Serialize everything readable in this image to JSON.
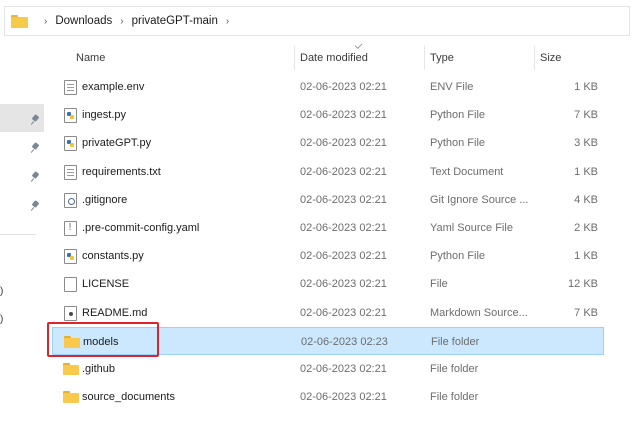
{
  "breadcrumb": {
    "items": [
      "Downloads",
      "privateGPT-main"
    ]
  },
  "columns": {
    "name": "Name",
    "date": "Date modified",
    "type": "Type",
    "size": "Size"
  },
  "files": [
    {
      "name": "example.env",
      "date": "02-06-2023 02:21",
      "type": "ENV File",
      "size": "1 KB",
      "icon": "document-icon"
    },
    {
      "name": "ingest.py",
      "date": "02-06-2023 02:21",
      "type": "Python File",
      "size": "7 KB",
      "icon": "python-file-icon"
    },
    {
      "name": "privateGPT.py",
      "date": "02-06-2023 02:21",
      "type": "Python File",
      "size": "3 KB",
      "icon": "python-file-icon"
    },
    {
      "name": "requirements.txt",
      "date": "02-06-2023 02:21",
      "type": "Text Document",
      "size": "1 KB",
      "icon": "text-document-icon"
    },
    {
      "name": ".gitignore",
      "date": "02-06-2023 02:21",
      "type": "Git Ignore Source ...",
      "size": "4 KB",
      "icon": "config-file-icon"
    },
    {
      "name": ".pre-commit-config.yaml",
      "date": "02-06-2023 02:21",
      "type": "Yaml Source File",
      "size": "2 KB",
      "icon": "yaml-file-icon"
    },
    {
      "name": "constants.py",
      "date": "02-06-2023 02:21",
      "type": "Python File",
      "size": "1 KB",
      "icon": "python-file-icon"
    },
    {
      "name": "LICENSE",
      "date": "02-06-2023 02:21",
      "type": "File",
      "size": "12 KB",
      "icon": "blank-file-icon"
    },
    {
      "name": "README.md",
      "date": "02-06-2023 02:21",
      "type": "Markdown Source...",
      "size": "7 KB",
      "icon": "markdown-file-icon"
    },
    {
      "name": "models",
      "date": "02-06-2023 02:23",
      "type": "File folder",
      "size": "",
      "icon": "folder-icon"
    },
    {
      "name": ".github",
      "date": "02-06-2023 02:21",
      "type": "File folder",
      "size": "",
      "icon": "folder-icon"
    },
    {
      "name": "source_documents",
      "date": "02-06-2023 02:21",
      "type": "File folder",
      "size": "",
      "icon": "folder-icon"
    }
  ],
  "selected_row": "models",
  "nav": {
    "truncated_labels": [
      ")",
      ")"
    ]
  },
  "colors": {
    "selection": "#cce8ff",
    "highlight_box": "#e0232b",
    "folder": "#f8c94a"
  }
}
